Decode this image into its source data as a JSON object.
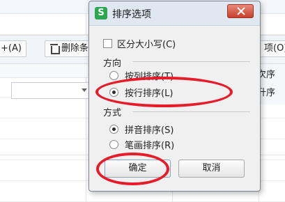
{
  "background": {
    "buttons": {
      "add_suffix": "+(A)",
      "delete_label": "删除条件",
      "options_label": "项(O)..."
    },
    "right_labels": [
      "次序",
      "升序"
    ]
  },
  "dialog": {
    "title": "排序选项",
    "app_icon_letter": "S",
    "case_sensitive_label": "区分大小写(C)",
    "direction_label": "方向",
    "direction_options": [
      {
        "label": "按列排序(T)",
        "selected": false
      },
      {
        "label": "按行排序(L)",
        "selected": true
      }
    ],
    "method_label": "方式",
    "method_options": [
      {
        "label": "拼音排序(S)",
        "selected": true
      },
      {
        "label": "笔画排序(R)",
        "selected": false
      }
    ],
    "ok_label": "确定",
    "cancel_label": "取消"
  },
  "colors": {
    "annotation": "#e51c2a",
    "app_icon": "#2ea550",
    "close_button": "#c7402c"
  }
}
